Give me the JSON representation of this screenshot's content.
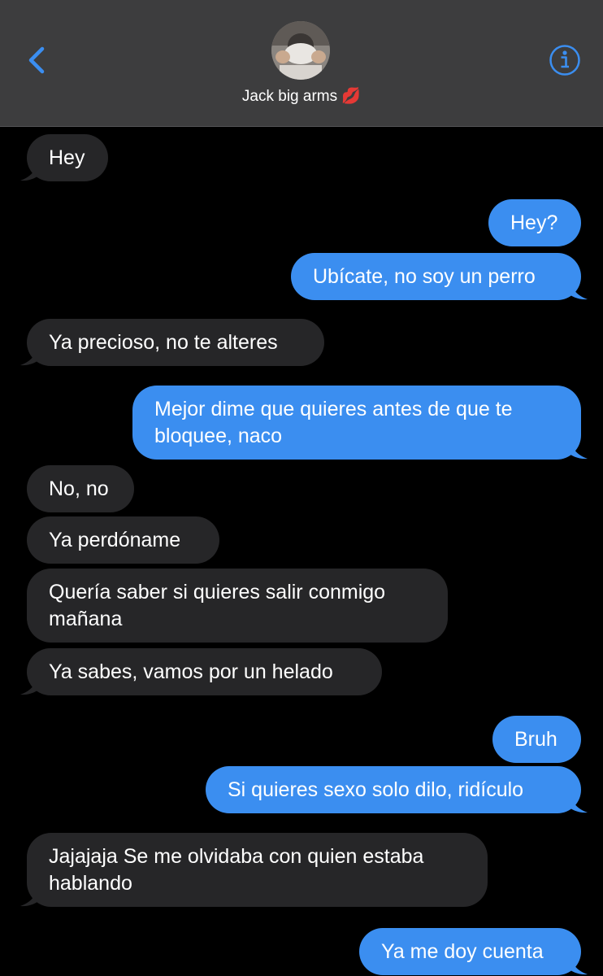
{
  "header": {
    "contact_name": "Jack big arms",
    "name_emoji": "💋",
    "back_icon": "chevron-left-icon",
    "info_icon": "info-circle-icon",
    "accent_color": "#3b8ef0"
  },
  "messages": [
    {
      "dir": "in",
      "text": "Hey"
    },
    {
      "dir": "out",
      "text": "Hey?"
    },
    {
      "dir": "out",
      "text": "Ubícate, no soy un perro"
    },
    {
      "dir": "in",
      "text": "Ya precioso, no te alteres"
    },
    {
      "dir": "out",
      "text": "Mejor dime que quieres antes de que te bloquee, naco"
    },
    {
      "dir": "in",
      "text": "No, no"
    },
    {
      "dir": "in",
      "text": "Ya perdóname"
    },
    {
      "dir": "in",
      "text": "Quería saber si quieres salir conmigo mañana"
    },
    {
      "dir": "in",
      "text": "Ya sabes, vamos por un helado"
    },
    {
      "dir": "out",
      "text": "Bruh"
    },
    {
      "dir": "out",
      "text": "Si quieres sexo solo dilo, ridículo"
    },
    {
      "dir": "in",
      "text": "Jajajaja Se me olvidaba con quien estaba hablando"
    },
    {
      "dir": "out",
      "text": "Ya me doy cuenta"
    }
  ]
}
